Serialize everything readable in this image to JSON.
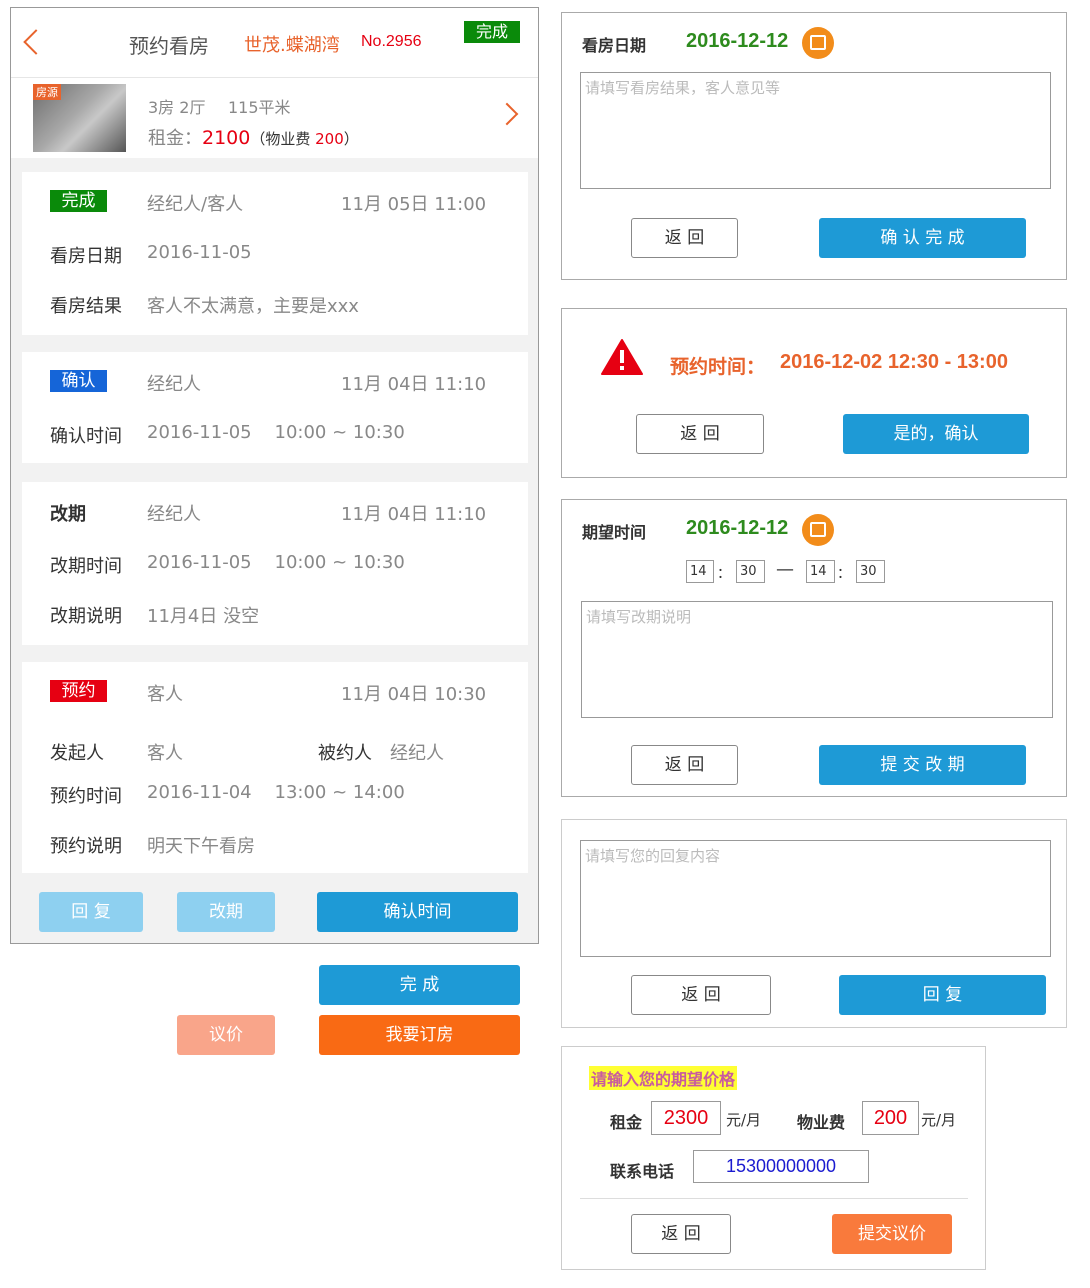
{
  "header": {
    "title": "预约看房",
    "project": "世茂.蝶湖湾",
    "number": "No.2956",
    "status_tag": "完成"
  },
  "house": {
    "photo_tag": "房源",
    "layout": "3房 2厅",
    "area": "115平米",
    "rent_label": "租金：",
    "rent": "2100",
    "fee_prefix": "（物业费 ",
    "fee": "200",
    "fee_suffix": "）"
  },
  "records": [
    {
      "tag": "完成",
      "tag_color": "#0a8a0a",
      "actor": "经纪人/客人",
      "time": "11月 05日 11:00",
      "rows": [
        {
          "label": "看房日期",
          "value": "2016-11-05"
        },
        {
          "label": "看房结果",
          "value": "客人不太满意，主要是xxx"
        }
      ]
    },
    {
      "tag": "确认",
      "tag_color": "#1565d8",
      "actor": "经纪人",
      "time": "11月 04日 11:10",
      "rows": [
        {
          "label": "确认时间",
          "value": "2016-11-05    10:00 ~ 10:30"
        }
      ]
    },
    {
      "tag": "改期",
      "tag_color": "",
      "actor": "经纪人",
      "time": "11月 04日 11:10",
      "rows": [
        {
          "label": "改期时间",
          "value": "2016-11-05    10:00 ~ 10:30"
        },
        {
          "label": "改期说明",
          "value": "11月4日 没空"
        }
      ]
    },
    {
      "tag": "预约",
      "tag_color": "#e60012",
      "actor": "客人",
      "time": "11月 04日 10:30",
      "initiator_label": "发起人",
      "initiator": "客人",
      "invitee_label": "被约人",
      "invitee": "经纪人",
      "rows": [
        {
          "label": "预约时间",
          "value": "2016-11-04    13:00 ~ 14:00"
        },
        {
          "label": "预约说明",
          "value": "明天下午看房"
        }
      ]
    }
  ],
  "actions": {
    "reply": "回 复",
    "reschedule": "改期",
    "confirm_time": "确认时间",
    "done": "完 成",
    "negotiate": "议价",
    "book": "我要订房"
  },
  "dialog_complete": {
    "label": "看房日期",
    "date": "2016-12-12",
    "placeholder": "请填写看房结果，客人意见等",
    "back": "返 回",
    "confirm": "确 认 完 成"
  },
  "dialog_confirm": {
    "label": "预约时间：",
    "value": "2016-12-02 12:30 - 13:00",
    "back": "返 回",
    "confirm": "是的，确认"
  },
  "dialog_reschedule": {
    "label": "期望时间",
    "date": "2016-12-12",
    "h1": "14",
    "m1": "30",
    "h2": "14",
    "m2": "30",
    "colon": "：",
    "dash": "—",
    "placeholder": "请填写改期说明",
    "back": "返 回",
    "submit": "提 交 改 期"
  },
  "dialog_reply": {
    "placeholder": "请填写您的回复内容",
    "back": "返 回",
    "reply": "回 复"
  },
  "dialog_price": {
    "title": "请输入您的期望价格",
    "rent_label": "租金",
    "rent": "2300",
    "rent_unit": "元/月",
    "fee_label": "物业费",
    "fee": "200",
    "fee_unit": "元/月",
    "phone_label": "联系电话",
    "phone": "15300000000",
    "back": "返 回",
    "submit": "提交议价"
  },
  "colors": {
    "accent_orange": "#e8632c",
    "price_red": "#e60012",
    "button_blue": "#1e9ad6",
    "date_green": "#2e8b1e"
  }
}
